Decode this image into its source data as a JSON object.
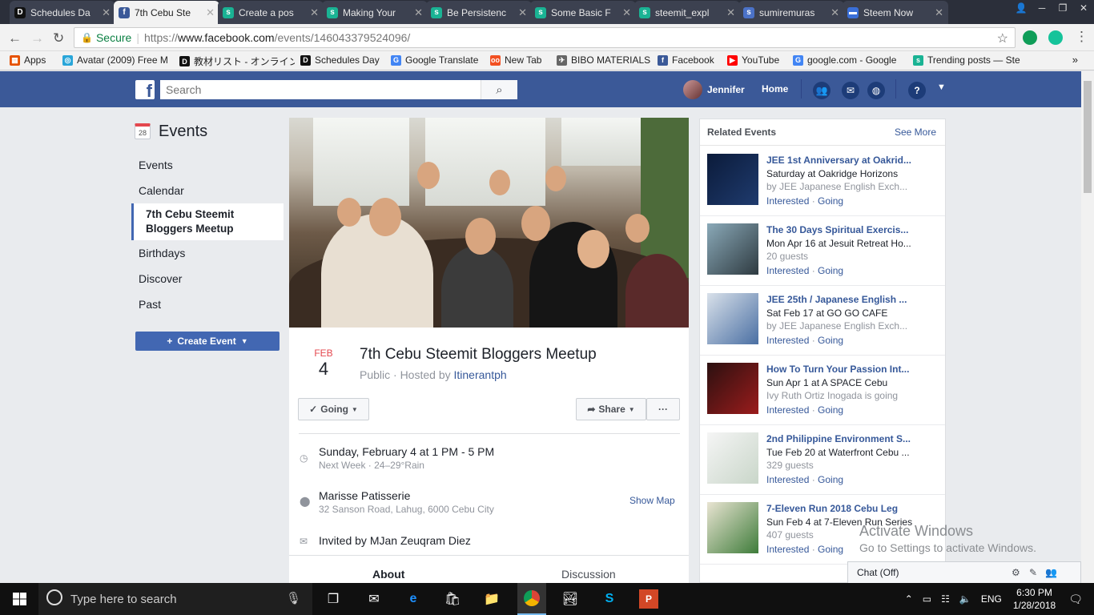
{
  "browser": {
    "tabs": [
      {
        "title": "Schedules Da",
        "icon": "D",
        "color": "#111111",
        "active": false
      },
      {
        "title": "7th Cebu Ste",
        "icon": "f",
        "color": "#3b5998",
        "active": true
      },
      {
        "title": "Create a pos",
        "icon": "s",
        "color": "#1ab394",
        "active": false
      },
      {
        "title": "Making Your",
        "icon": "s",
        "color": "#1ab394",
        "active": false
      },
      {
        "title": "Be Persistenc",
        "icon": "s",
        "color": "#1ab394",
        "active": false
      },
      {
        "title": "Some Basic F",
        "icon": "s",
        "color": "#1ab394",
        "active": false
      },
      {
        "title": "steemit_expl",
        "icon": "s",
        "color": "#1ab394",
        "active": false
      },
      {
        "title": "sumiremuras",
        "icon": "s",
        "color": "#4b72c8",
        "active": false
      },
      {
        "title": "Steem Now",
        "icon": "▬",
        "color": "#3a6fd8",
        "active": false
      }
    ],
    "secure_label": "Secure",
    "url_scheme": "https://",
    "url_host": "www.facebook.com",
    "url_path": "/events/146043379524096/",
    "bookmarks": [
      {
        "label": "Apps",
        "icon": "▦",
        "color": "#e65100"
      },
      {
        "label": "Avatar (2009) Free M",
        "icon": "◎",
        "color": "#29a6d9"
      },
      {
        "label": "教材リスト - オンライン英",
        "icon": "D",
        "color": "#111111"
      },
      {
        "label": "Schedules Day",
        "icon": "D",
        "color": "#111111"
      },
      {
        "label": "Google Translate",
        "icon": "G",
        "color": "#4285f4"
      },
      {
        "label": "New Tab",
        "icon": "oo",
        "color": "#f25022"
      },
      {
        "label": "BIBO MATERIALS",
        "icon": "✈",
        "color": "#666666"
      },
      {
        "label": "Facebook",
        "icon": "f",
        "color": "#3b5998"
      },
      {
        "label": "YouTube",
        "icon": "▶",
        "color": "#ff0000"
      },
      {
        "label": "google.com - Google",
        "icon": "G",
        "color": "#4285f4"
      },
      {
        "label": "Trending posts — Ste",
        "icon": "s",
        "color": "#1ab394"
      }
    ]
  },
  "fb": {
    "search_placeholder": "Search",
    "user_name": "Jennifer",
    "home_label": "Home"
  },
  "left_nav": {
    "title": "Events",
    "calendar_day": "28",
    "items": [
      "Events",
      "Calendar",
      "7th Cebu Steemit Bloggers Meetup",
      "Birthdays",
      "Discover",
      "Past"
    ],
    "create_label": "Create Event"
  },
  "event": {
    "month": "FEB",
    "day": "4",
    "title": "7th Cebu Steemit Bloggers Meetup",
    "visibility": "Public · Hosted by ",
    "host": "Itinerantph",
    "going_label": "Going",
    "share_label": "Share",
    "more_label": "···",
    "date_line": "Sunday, February 4 at 1 PM - 5 PM",
    "date_sub": "Next Week · 24–29°Rain",
    "venue": "Marisse Patisserie",
    "address": "32 Sanson Road, Lahug, 6000 Cebu City",
    "show_map": "Show Map",
    "invited": "Invited by MJan Zeuqram Diez",
    "tab_about": "About",
    "tab_discussion": "Discussion"
  },
  "related": {
    "title": "Related Events",
    "see_more": "See More",
    "interested": "Interested",
    "going": "Going",
    "items": [
      {
        "name": "JEE 1st Anniversary at Oakrid...",
        "line1": "Saturday at Oakridge Horizons",
        "line2": "by JEE Japanese English Exch..."
      },
      {
        "name": "The 30 Days Spiritual Exercis...",
        "line1": "Mon Apr 16 at Jesuit Retreat Ho...",
        "line2": "20 guests"
      },
      {
        "name": "JEE 25th / Japanese English ...",
        "line1": "Sat Feb 17 at GO GO CAFE",
        "line2": "by JEE Japanese English Exch..."
      },
      {
        "name": "How To Turn Your Passion Int...",
        "line1": "Sun Apr 1 at A SPACE Cebu",
        "line2": "Ivy Ruth Ortiz Inogada is going"
      },
      {
        "name": "2nd Philippine Environment S...",
        "line1": "Tue Feb 20 at Waterfront Cebu ...",
        "line2": "329 guests"
      },
      {
        "name": "7-Eleven Run 2018 Cebu Leg",
        "line1": "Sun Feb 4 at 7-Eleven Run Series",
        "line2": "407 guests"
      }
    ]
  },
  "overlay": {
    "activate_title": "Activate Windows",
    "activate_sub": "Go to Settings to activate Windows.",
    "chat_label": "Chat (Off)"
  },
  "taskbar": {
    "search_placeholder": "Type here to search",
    "lang": "ENG",
    "time": "6:30 PM",
    "date": "1/28/2018"
  }
}
